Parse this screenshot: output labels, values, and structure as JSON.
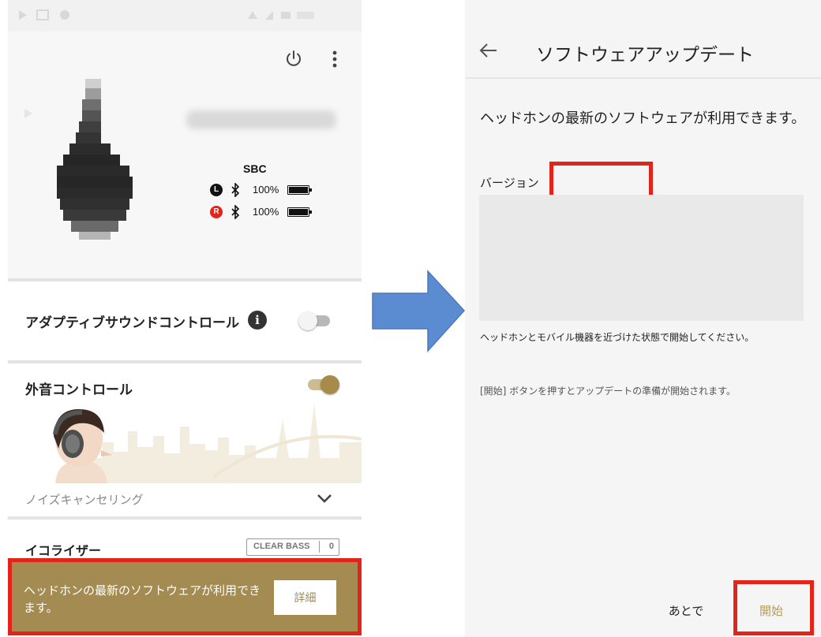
{
  "left_screen": {
    "device": {
      "codec": "SBC",
      "batteries": [
        {
          "side": "L",
          "percent": "100%",
          "badge_color": "#111111"
        },
        {
          "side": "R",
          "percent": "100%",
          "badge_color": "#e3241b"
        }
      ]
    },
    "adaptive_sound_control": {
      "label": "アダプティブサウンドコントロール",
      "enabled": false
    },
    "ambient_sound_control": {
      "label": "外音コントロール",
      "enabled": true,
      "mode": "ノイズキャンセリング"
    },
    "equalizer": {
      "label": "イコライザー",
      "clear_bass_label": "CLEAR BASS",
      "clear_bass_value": "0"
    },
    "update_banner": {
      "message": "ヘッドホンの最新のソフトウェアが利用できます。",
      "button_label": "詳細"
    }
  },
  "right_screen": {
    "title": "ソフトウェアアップデート",
    "headline": "ヘッドホンの最新のソフトウェアが利用できます。",
    "version_label": "バージョン",
    "version_value": "",
    "note_1": "ヘッドホンとモバイル機器を近づけた状態で開始してください。",
    "note_2": "[開始] ボタンを押すとアップデートの準備が開始されます。",
    "later_label": "あとで",
    "start_label": "開始"
  },
  "colors": {
    "accent_gold": "#a38b52",
    "highlight_red": "#e3241b",
    "arrow_blue": "#5b8bd0"
  }
}
